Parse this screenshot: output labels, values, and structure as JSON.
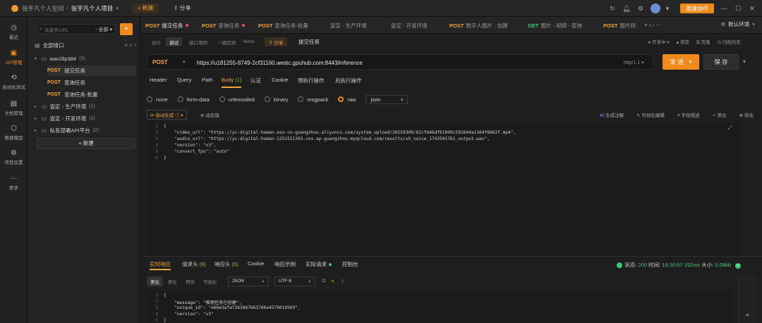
{
  "title": {
    "workspace": "张宇凡个人空间",
    "sep": "/",
    "project": "张宇凡个人项目",
    "new_btn": "+ 新建",
    "share_btn": "分享",
    "invite_btn": "邀请协作"
  },
  "leftnav": [
    {
      "label": "最近",
      "icon": "clock-icon"
    },
    {
      "label": "API管理",
      "icon": "api-icon"
    },
    {
      "label": "自动化测试",
      "icon": "automation-icon"
    },
    {
      "label": "文档管理",
      "icon": "document-icon"
    },
    {
      "label": "数据模型",
      "icon": "data-model-icon"
    },
    {
      "label": "项目设置",
      "icon": "settings-icon"
    },
    {
      "label": "更多",
      "icon": "more-icon"
    }
  ],
  "sidebar": {
    "search_placeholder": "关键字/URL",
    "filter": "全部",
    "root": "全部接口",
    "folder1": {
      "name": "wav2lip384",
      "count": "(3)"
    },
    "items": [
      {
        "method": "POST",
        "name": "提交任务"
      },
      {
        "method": "POST",
        "name": "查询任务"
      },
      {
        "method": "POST",
        "name": "查询任务-批量"
      }
    ],
    "folders": [
      {
        "name": "壹定 - 生产环境",
        "count": "(1)"
      },
      {
        "name": "壹定 - 开发环境",
        "count": "(3)"
      },
      {
        "name": "私有部署API平台",
        "count": "(2)"
      }
    ],
    "new_btn": "+ 新建"
  },
  "tabs": [
    {
      "method": "POST",
      "name": "提交任务",
      "dot": true
    },
    {
      "method": "POST",
      "name": "查询任务",
      "dot": true
    },
    {
      "method": "POST",
      "name": "查询任务-批量",
      "dot": false
    },
    {
      "method": "",
      "name": "壹定 - 生产环境",
      "dot": false
    },
    {
      "method": "",
      "name": "壹定 - 开发环境",
      "dot": false
    },
    {
      "method": "POST",
      "name": "数字人图片 - 创建",
      "dot": false
    },
    {
      "method": "GET",
      "name": "图片 - 视频 - 查询",
      "dot": false
    },
    {
      "method": "POST",
      "name": "图片转:",
      "dot": false
    }
  ],
  "env": "默认环境",
  "subtabs": {
    "design": "设计",
    "debug": "调试",
    "case": "接口用例",
    "oneclick": "一键压测",
    "mock": "Mock",
    "share": "分享",
    "title": "提交任务"
  },
  "righttools": {
    "dev": "开发中",
    "lock": "锁定",
    "id": "克隆",
    "history": "归档历史"
  },
  "request": {
    "method": "POST",
    "url": "https://u181255-8749-2cf31160.westc.gpuhub.com:8443/inference",
    "http": "http/1.1",
    "send": "发 送",
    "save": "保 存"
  },
  "reqtabs": [
    {
      "label": "Header"
    },
    {
      "label": "Query"
    },
    {
      "label": "Path"
    },
    {
      "label": "Body",
      "count": "(1)"
    },
    {
      "label": "认证"
    },
    {
      "label": "Cookie"
    },
    {
      "label": "预执行操作"
    },
    {
      "label": "后执行操作"
    }
  ],
  "body_types": [
    "none",
    "form-data",
    "urlencoded",
    "binary",
    "msgpack",
    "raw"
  ],
  "body_format": "json",
  "autogen": "自动生成",
  "add_comment": "动态值",
  "tools": {
    "ai": "AI",
    "ai_label": "生成注解",
    "visual": "可视化编辑",
    "field": "字段描述",
    "beautify": "美化",
    "compress": "简化"
  },
  "body_lines": [
    "{",
    "    \"video_url\": \"https://yc-digital-human.oss-cn-guangzhou.aliyuncs.com/system_upload/20250309/62cf64bdf61099c592644a1364f8d62f.mp4\",",
    "    \"audio_url\": \"https://yc-digital-human-1251511393.cos.ap-guangzhou.myqcloud.com/results/xh_voice_1743501761_output.wav\",",
    "    \"version\": \"v3\",",
    "    \"convert_fps\": \"auto\"",
    "}"
  ],
  "resptabs": [
    {
      "label": "实时响应"
    },
    {
      "label": "请求头",
      "count": "(8)"
    },
    {
      "label": "响应头",
      "count": "(5)"
    },
    {
      "label": "Cookie"
    },
    {
      "label": "响应示例"
    },
    {
      "label": "实际请求"
    },
    {
      "label": "控制台"
    }
  ],
  "status": {
    "label": "状态:",
    "code": "200",
    "time_label": "时间:",
    "time": "16:30:57",
    "ms": "192ms",
    "size_label": "大小:",
    "size": "0.09kb"
  },
  "resptools": {
    "beautify": "美化",
    "raw": "原生",
    "preview": "预览",
    "visual": "可视化",
    "fmt": "JSON",
    "enc": "UTF-8"
  },
  "resp_lines": [
    "{",
    "    \"message\": \"推理任务已创建\",",
    "    \"unique_id\": \"e66e3afa72b3867663766a4579010509\",",
    "    \"version\": \"v3\"",
    "}"
  ]
}
